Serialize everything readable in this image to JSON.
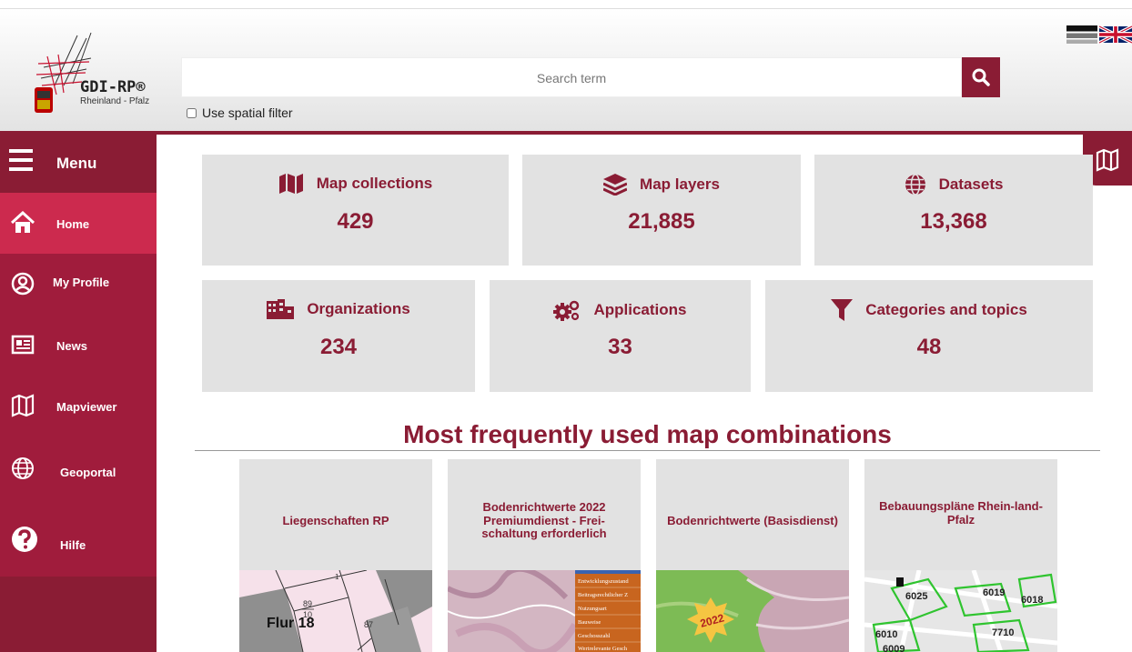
{
  "header": {
    "logo_title": "GDI-RP®",
    "logo_subtitle": "Rheinland - Pfalz",
    "search_placeholder": "Search term",
    "spatial_filter_label": "Use spatial filter"
  },
  "sidebar": {
    "menu_label": "Menu",
    "items": [
      {
        "label": "Home",
        "icon": "home-icon"
      },
      {
        "label": "My Profile",
        "icon": "user-circle-icon"
      },
      {
        "label": "News",
        "icon": "newspaper-icon"
      },
      {
        "label": "Mapviewer",
        "icon": "map-icon"
      },
      {
        "label": "Geoportal",
        "icon": "globe-icon"
      },
      {
        "label": "Hilfe",
        "icon": "help-icon"
      }
    ]
  },
  "stats": [
    {
      "label": "Map collections",
      "value": "429",
      "icon": "map-icon"
    },
    {
      "label": "Map layers",
      "value": "21,885",
      "icon": "layers-icon"
    },
    {
      "label": "Datasets",
      "value": "13,368",
      "icon": "globe-icon"
    },
    {
      "label": "Organizations",
      "value": "234",
      "icon": "buildings-icon"
    },
    {
      "label": "Applications",
      "value": "33",
      "icon": "gears-icon"
    },
    {
      "label": "Categories and topics",
      "value": "48",
      "icon": "filter-icon"
    }
  ],
  "section": {
    "title": "Most frequently used map combinations"
  },
  "combinations": [
    {
      "title": "Liegenschaften RP"
    },
    {
      "title": "Bodenrichtwerte 2022 Premiumdienst - Frei-schaltung erforderlich"
    },
    {
      "title": "Bodenrichtwerte (Basisdienst)"
    },
    {
      "title": "Bebauungspläne Rhein-land-Pfalz"
    }
  ],
  "thumbs": {
    "flur_label": "Flur 18",
    "parcel_labels": [
      "89",
      "10",
      "87",
      "1"
    ],
    "menu_lines": [
      "Entwicklungszustand",
      "Beitragsrechtlicher Z",
      "Nutzungsart",
      "Bauweise",
      "Geschosszahl",
      "Wertrelevante Gesch"
    ],
    "badge": "2022",
    "plan_labels": [
      "6025",
      "6019",
      "6018",
      "6010",
      "7710",
      "6009"
    ]
  },
  "colors": {
    "brand": "#8a1c34",
    "active": "#cc2a4e",
    "nav": "#a01c3c"
  }
}
